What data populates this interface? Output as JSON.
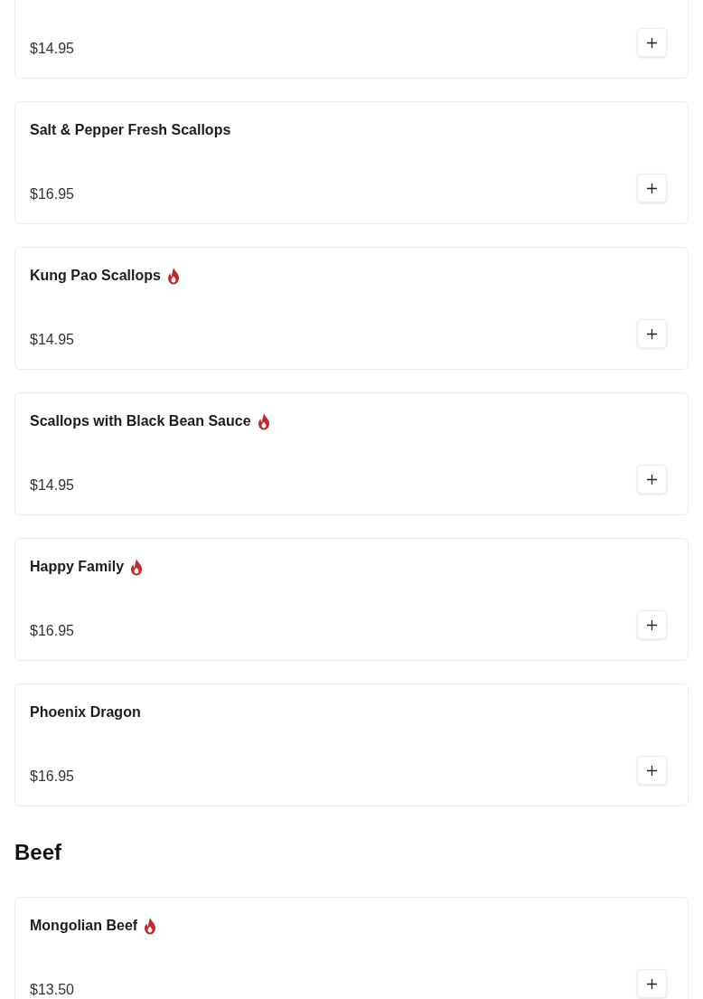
{
  "sections": [
    {
      "items": [
        {
          "price": "$14.95",
          "spicy": false
        },
        {
          "name": "Salt & Pepper Fresh Scallops",
          "price": "$16.95",
          "spicy": false
        },
        {
          "name": "Kung Pao Scallops",
          "price": "$14.95",
          "spicy": true
        },
        {
          "name": "Scallops with Black Bean Sauce",
          "price": "$14.95",
          "spicy": true
        },
        {
          "name": "Happy Family",
          "price": "$16.95",
          "spicy": true
        },
        {
          "name": "Phoenix Dragon",
          "price": "$16.95",
          "spicy": false
        }
      ]
    },
    {
      "title": "Beef",
      "items": [
        {
          "name": "Mongolian Beef",
          "price": "$13.50",
          "spicy": true
        }
      ]
    }
  ]
}
